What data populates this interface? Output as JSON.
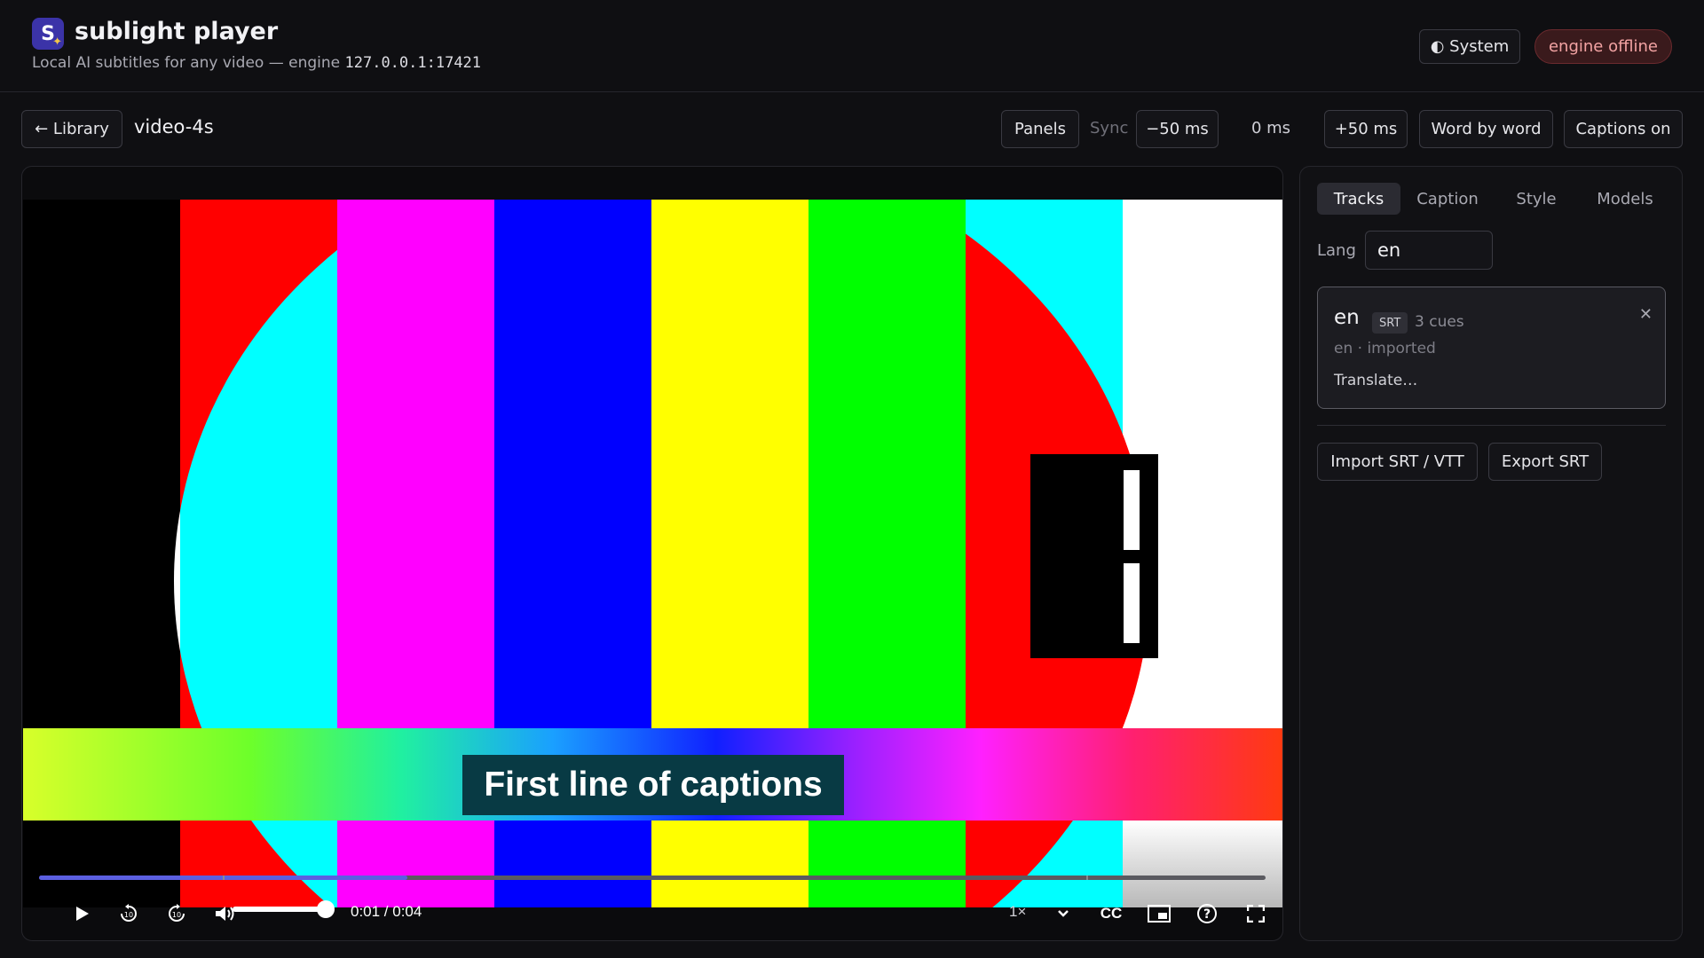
{
  "app": {
    "logo_letter": "S",
    "title": "sublight player",
    "subtitle_prefix": "Local AI subtitles for any video — engine",
    "engine_address": "127.0.0.1:17421",
    "theme_label": "◐ System",
    "engine_status": "engine offline"
  },
  "toolbar": {
    "back_label": "← Library",
    "video_name": "video-4s",
    "panels_label": "Panels",
    "sync_label": "Sync",
    "sync_minus_label": "−50 ms",
    "sync_value": "0 ms",
    "sync_plus_label": "+50 ms",
    "word_by_word_label": "Word by word",
    "captions_label": "Captions on"
  },
  "player": {
    "caption_text": "First line of captions",
    "current_time": "0:01",
    "duration": "0:04",
    "time_display": "0:01 / 0:04",
    "progress_fraction": 0.3,
    "volume_fraction": 1.0,
    "speed_label": "1×",
    "cc_label": "CC"
  },
  "side_panel": {
    "tabs": [
      {
        "label": "Tracks",
        "active": true
      },
      {
        "label": "Caption",
        "active": false
      },
      {
        "label": "Style",
        "active": false
      },
      {
        "label": "Models",
        "active": false
      }
    ],
    "lang_label": "Lang",
    "lang_value": "en",
    "track": {
      "lang": "en",
      "format": "SRT",
      "cues": "3 cues",
      "meta": "en · imported",
      "translate_label": "Translate…",
      "remove_icon": "close-icon"
    },
    "import_label": "Import SRT / VTT",
    "export_label": "Export SRT"
  },
  "colors": {
    "accent": "#5b5fe0",
    "offline_bg": "#3a1a1c",
    "offline_text": "#f3a3a3",
    "caption_bg": "#083a44"
  }
}
